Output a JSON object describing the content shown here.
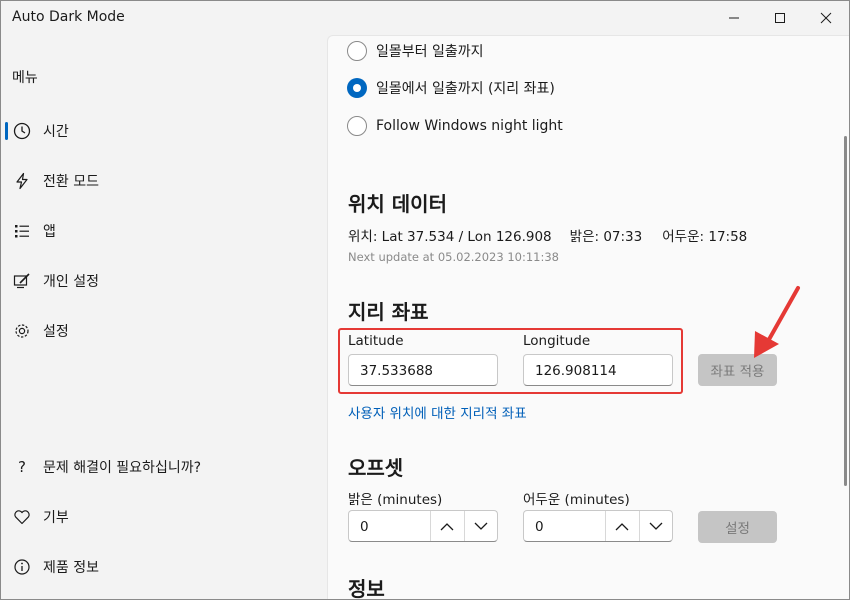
{
  "window": {
    "title": "Auto Dark Mode"
  },
  "sidebar": {
    "menu_label": "메뉴",
    "items": [
      {
        "label": "시간",
        "icon": "clock-icon"
      },
      {
        "label": "전환 모드",
        "icon": "lightning-icon"
      },
      {
        "label": "앱",
        "icon": "list-icon"
      },
      {
        "label": "개인 설정",
        "icon": "personalize-icon"
      },
      {
        "label": "설정",
        "icon": "gear-icon"
      }
    ],
    "bottom_items": [
      {
        "label": "문제 해결이 필요하십니까?",
        "icon": "question-icon"
      },
      {
        "label": "기부",
        "icon": "heart-icon"
      },
      {
        "label": "제품 정보",
        "icon": "info-icon"
      }
    ]
  },
  "content": {
    "radio_options": [
      {
        "label": "일몰부터 일출까지",
        "checked": false
      },
      {
        "label": "일몰에서 일출까지 (지리 좌표)",
        "checked": true
      },
      {
        "label": "Follow Windows night light",
        "checked": false
      }
    ],
    "location": {
      "title": "위치 데이터",
      "position": "위치: Lat 37.534 / Lon 126.908",
      "sunrise": "밝은: 07:33",
      "sunset": "어두운: 17:58",
      "next_update": "Next update at 05.02.2023 10:11:38"
    },
    "geo": {
      "title": "지리 좌표",
      "latitude_label": "Latitude",
      "latitude_value": "37.533688",
      "longitude_label": "Longitude",
      "longitude_value": "126.908114",
      "apply_button": "좌표 적용",
      "link": "사용자 위치에 대한 지리적 좌표"
    },
    "offset": {
      "title": "오프셋",
      "light_label": "밝은 (minutes)",
      "light_value": "0",
      "dark_label": "어두운 (minutes)",
      "dark_value": "0",
      "set_button": "설정"
    },
    "info_title": "정보"
  },
  "colors": {
    "accent": "#0067c0",
    "highlight_border": "#e53935",
    "annotation_arrow": "#e53935"
  }
}
